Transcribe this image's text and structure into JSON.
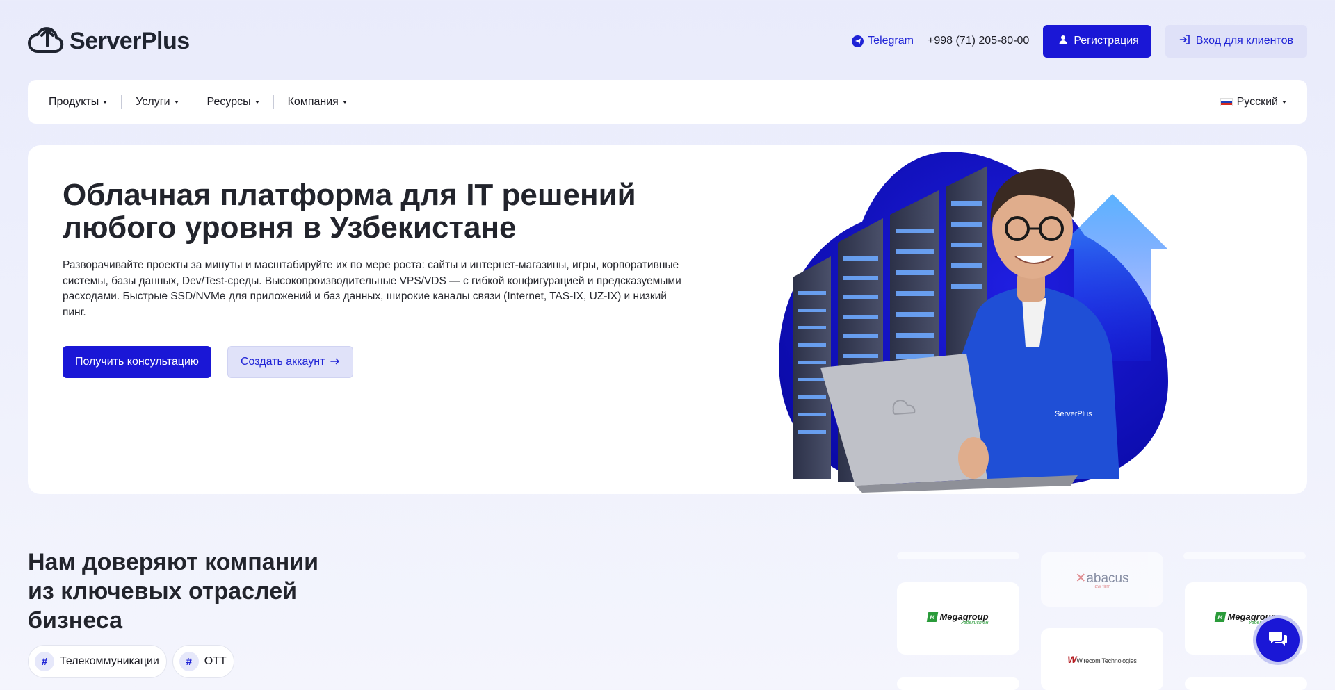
{
  "header": {
    "logo_text": "ServerPlus",
    "telegram_label": "Telegram",
    "phone": "+998 (71) 205-80-00",
    "register_label": "Регистрация",
    "login_label": "Вход для клиентов"
  },
  "nav": {
    "items": [
      {
        "label": "Продукты"
      },
      {
        "label": "Услуги"
      },
      {
        "label": "Ресурсы"
      },
      {
        "label": "Компания"
      }
    ],
    "language": "Русский"
  },
  "hero": {
    "title": "Облачная платформа для IT решений любого уровня в Узбекистане",
    "description": "Разворачивайте проекты за минуты и масштабируйте их по мере роста: сайты и интернет-магазины, игры, корпоративные системы, базы данных, Dev/Test-среды. Высокопроизводительные VPS/VDS — с гибкой конфигурацией и предсказуемыми расходами. Быстрые SSD/NVMe для приложений и баз данных, широкие каналы связи (Internet, TAS-IX, UZ-IX) и низкий пинг.",
    "consult_label": "Получить консультацию",
    "create_label": "Создать аккаунт"
  },
  "trust": {
    "title": "Нам доверяют компании из ключевых отраслей бизнеса",
    "tags": [
      {
        "label": "Телекоммуникации"
      },
      {
        "label": "OTT"
      }
    ],
    "logos": {
      "megagroup": "Megagroup",
      "megagroup_sub": "Узбекистан",
      "abacus": "abacus",
      "abacus_sub": "law firm",
      "wirecom": "Wirecom Technologies",
      "laptop_brand": "ServerPlus"
    }
  },
  "colors": {
    "accent": "#1a17d6",
    "accent_light": "#e0e2f9",
    "background": "#eceefb"
  },
  "icons": {
    "logo": "cloud-upload-icon",
    "telegram": "telegram-icon",
    "register": "user-icon",
    "login": "login-icon",
    "arrow": "arrow-right-icon",
    "chat": "chat-icon"
  }
}
